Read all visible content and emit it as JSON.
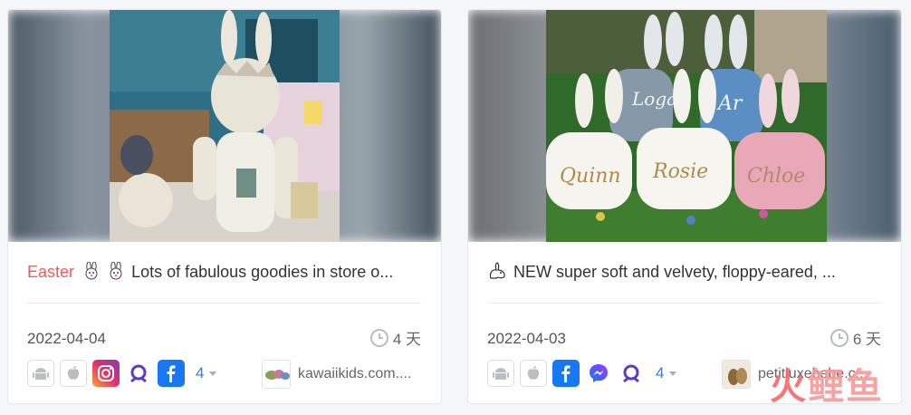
{
  "cards": [
    {
      "tag": "Easter",
      "title": "Lots of fabulous goodies in store o...",
      "date": "2022-04-04",
      "age": "4 天",
      "platforms": [
        "android-icon",
        "apple-icon",
        "instagram-icon",
        "audience-network-icon",
        "facebook-icon"
      ],
      "more_count": "4",
      "advertiser": "kawaiikids.com...."
    },
    {
      "tag": "",
      "title": "NEW super soft and velvety, floppy-eared, ...",
      "date": "2022-04-03",
      "age": "6 天",
      "platforms": [
        "android-icon",
        "apple-icon",
        "facebook-icon",
        "messenger-icon",
        "audience-network-icon"
      ],
      "more_count": "4",
      "advertiser": "petitluxebebe.c..."
    }
  ],
  "photo_text": {
    "bags": [
      "Logan",
      "Ar",
      "Quinn",
      "Rosie",
      "Chloe"
    ]
  },
  "watermark": {
    "part1": "火",
    "part2": "鲤鱼"
  },
  "colors": {
    "tag": "#f15b5b",
    "link": "#3a7bd5",
    "facebook": "#1877f2"
  }
}
